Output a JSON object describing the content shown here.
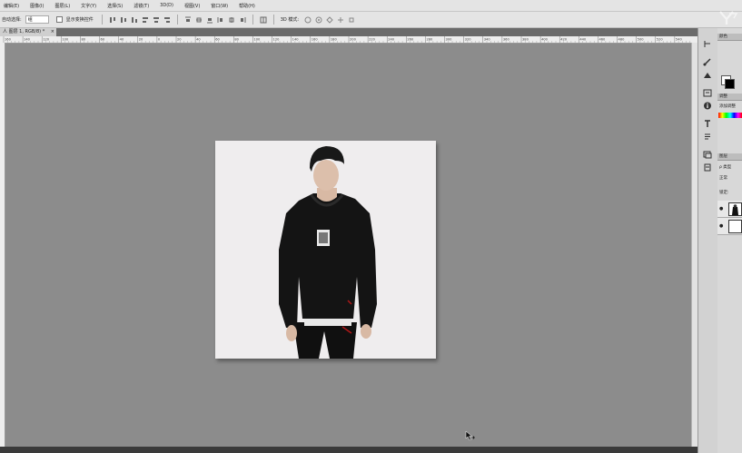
{
  "menu": {
    "items": [
      "编辑(E)",
      "图像(I)",
      "图层(L)",
      "文字(Y)",
      "选择(S)",
      "滤镜(T)",
      "3D(D)",
      "视图(V)",
      "窗口(W)",
      "帮助(H)"
    ]
  },
  "options": {
    "auto_select_label": "自动选择:",
    "auto_select_value": "组",
    "show_transform_label": "显示变换控件",
    "mode_label": "3D 模式:"
  },
  "document": {
    "tab_title": "人 图层 1, RGB/8) *",
    "close_glyph": "×"
  },
  "ruler": {
    "labels": [
      "160",
      "140",
      "120",
      "100",
      "80",
      "60",
      "40",
      "20",
      "0",
      "20",
      "40",
      "60",
      "80",
      "100",
      "120",
      "140",
      "160",
      "180",
      "200",
      "220",
      "240",
      "260",
      "280",
      "300",
      "320",
      "340",
      "360",
      "380",
      "400",
      "420",
      "440",
      "460",
      "480",
      "500",
      "520",
      "540"
    ]
  },
  "panels": {
    "color_tab": "颜色",
    "adjust_tab": "调整",
    "adjust_add_label": "添加调整",
    "layers_tab": "图层",
    "kind_label": "ρ 类型",
    "blend_mode": "正常",
    "lock_label": "锁定:"
  },
  "colors": {
    "canvas_bg": "#8c8c8c",
    "photo_bg": "#efedee",
    "hoodie": "#111111",
    "accent_red": "#b01818"
  },
  "icons": [
    "move-icon",
    "align-icon",
    "distribute-icon",
    "3d-rotate-icon",
    "history-icon",
    "brush-icon",
    "info-icon",
    "character-icon",
    "layer-comps-icon",
    "cursor-arrow-icon",
    "eye-icon"
  ]
}
